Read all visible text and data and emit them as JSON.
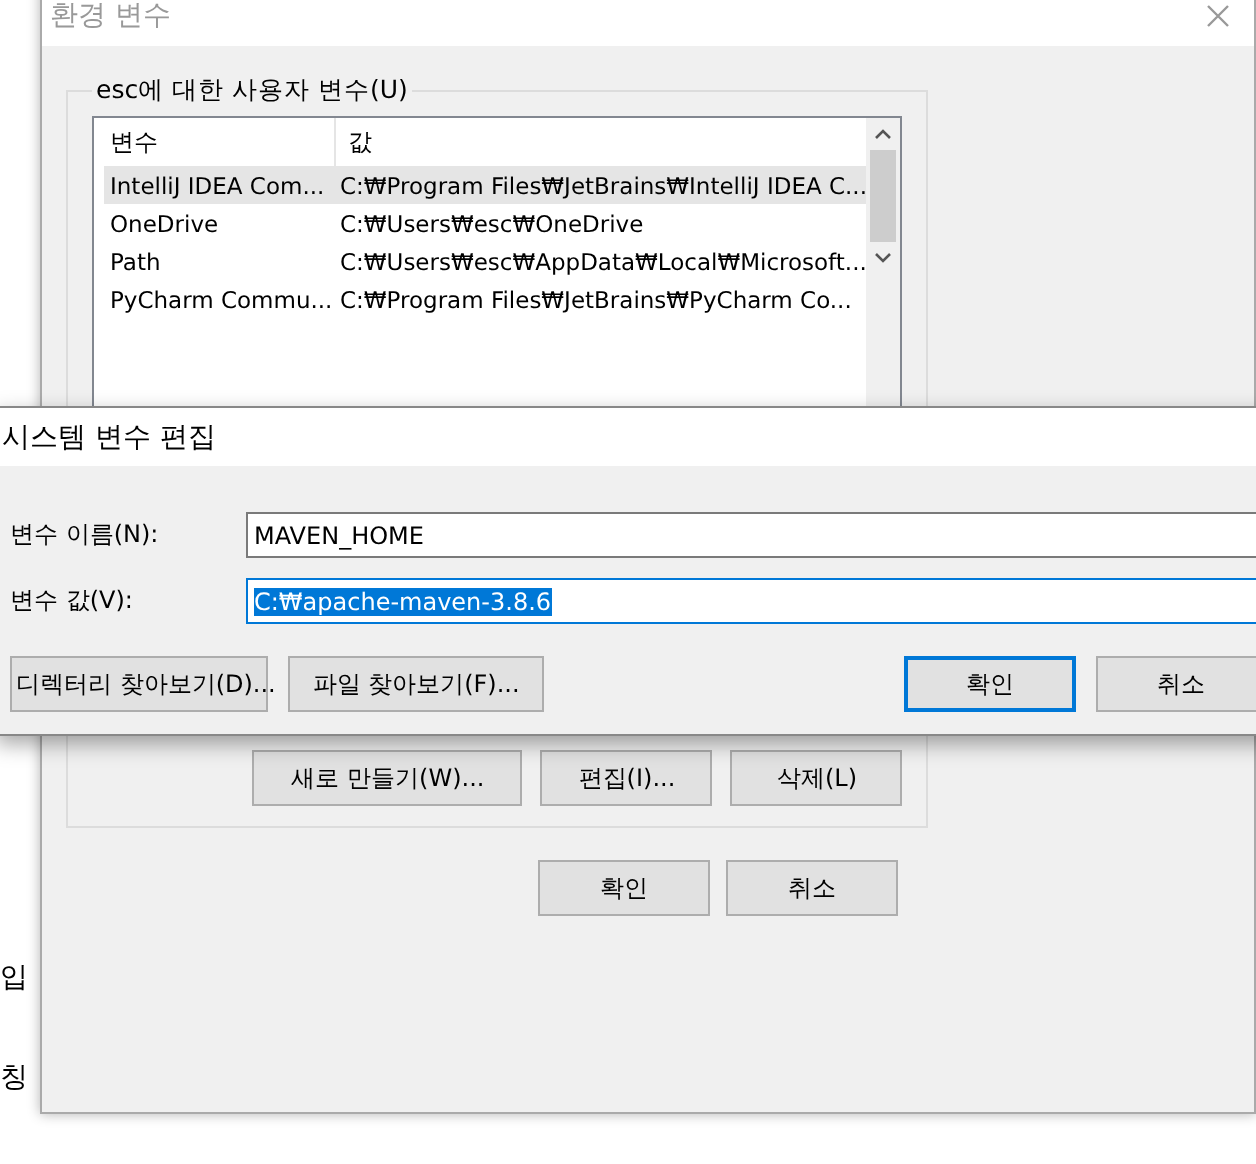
{
  "background_page": {
    "texts": [
      "입",
      "칭"
    ]
  },
  "env_window": {
    "title": "환경 변수",
    "active": false,
    "user_group": {
      "label": "esc에 대한 사용자 변수(U)",
      "columns": [
        "변수",
        "값"
      ],
      "rows": [
        {
          "name": "IntelliJ IDEA Com...",
          "value": "C:₩Program Files₩JetBrains₩IntelliJ IDEA C...",
          "selected": true
        },
        {
          "name": "OneDrive",
          "value": "C:₩Users₩esc₩OneDrive",
          "selected": false
        },
        {
          "name": "Path",
          "value": "C:₩Users₩esc₩AppData₩Local₩Microsoft...",
          "selected": false
        },
        {
          "name": "PyCharm Commu...",
          "value": "C:₩Program Files₩JetBrains₩PyCharm Co...",
          "selected": false
        }
      ],
      "buttons": [
        "새로 만들기(W)...",
        "편집(I)...",
        "삭제(L)"
      ]
    },
    "buttons": [
      "확인",
      "취소"
    ]
  },
  "edit_window": {
    "title": "시스템 변수 편집",
    "fields": [
      {
        "label": "변수 이름(N):",
        "value": "MAVEN_HOME",
        "text_selected": false
      },
      {
        "label": "변수 값(V):",
        "value": "C:₩apache-maven-3.8.6",
        "text_selected": true
      }
    ],
    "left_buttons": [
      "디렉터리 찾아보기(D)...",
      "파일 찾아보기(F)..."
    ],
    "buttons": [
      {
        "label": "확인",
        "default": true
      },
      {
        "label": "취소",
        "default": false
      }
    ]
  }
}
